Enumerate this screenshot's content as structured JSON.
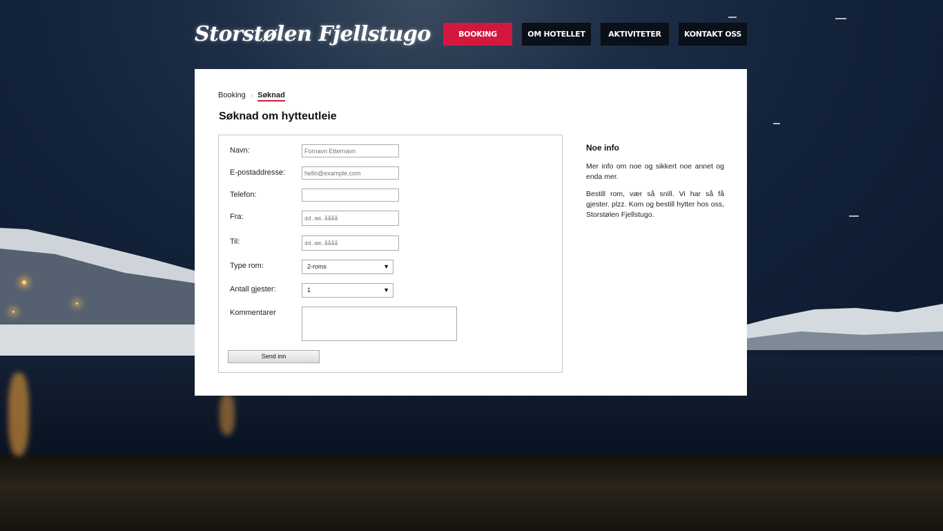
{
  "header": {
    "logo": "Storstølen Fjellstugo",
    "nav": [
      {
        "label": "BOOKING",
        "active": true
      },
      {
        "label": "OM HOTELLET",
        "active": false
      },
      {
        "label": "AKTIVITETER",
        "active": false
      },
      {
        "label": "KONTAKT OSS",
        "active": false
      }
    ]
  },
  "breadcrumb": {
    "parent": "Booking",
    "separator": "›",
    "current": "Søknad"
  },
  "page_title": "Søknad om hytteutleie",
  "form": {
    "name_label": "Navn:",
    "name_placeholder": "Fornavn Etternavn",
    "email_label": "E-postaddresse:",
    "email_placeholder": "hello@example.com",
    "phone_label": "Telefon:",
    "phone_value": "",
    "from_label": "Fra:",
    "from_placeholder": "dd.mm.åååå",
    "to_label": "Til:",
    "to_placeholder": "dd.mm.åååå",
    "room_type_label": "Type rom:",
    "room_type_value": "2-roms",
    "guests_label": "Antall gjester:",
    "guests_value": "1",
    "comments_label": "Kommentarer",
    "comments_value": "",
    "submit_label": "Send inn"
  },
  "info": {
    "title": "Noe info",
    "paragraph1": "Mer info om noe og sikkert noe annet og enda mer.",
    "paragraph2": "Bestill rom, vær så snill. Vi har så få gjester. plzz. Kom og bestill hytter hos oss, Storstølen Fjellstugo."
  },
  "colors": {
    "accent": "#d4183d",
    "nav_bg": "#0a0f18",
    "panel_bg": "#ffffff"
  },
  "select_arrow_icon": "▼"
}
